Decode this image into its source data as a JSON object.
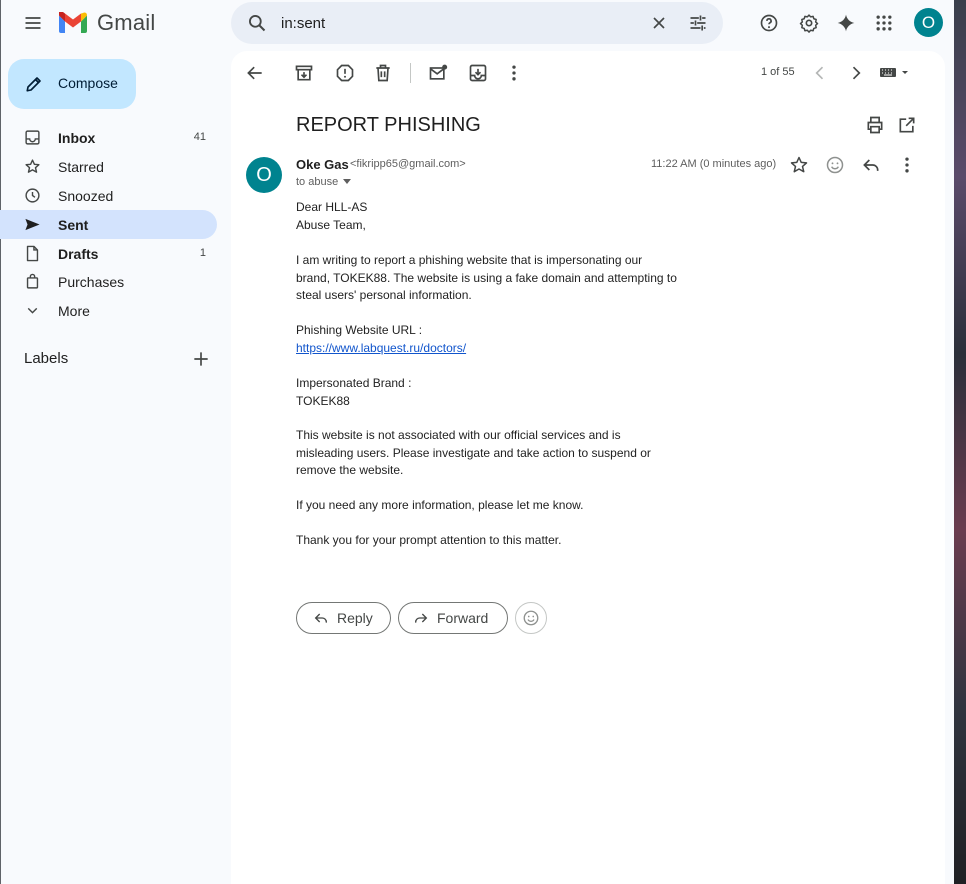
{
  "app": {
    "name": "Gmail"
  },
  "search": {
    "query": "in:sent"
  },
  "account": {
    "initial": "O"
  },
  "compose": {
    "label": "Compose"
  },
  "sidebar": {
    "items": [
      {
        "label": "Inbox",
        "count": "41",
        "icon": "inbox-icon"
      },
      {
        "label": "Starred",
        "count": "",
        "icon": "star-icon"
      },
      {
        "label": "Snoozed",
        "count": "",
        "icon": "clock-icon"
      },
      {
        "label": "Sent",
        "count": "",
        "icon": "send-icon"
      },
      {
        "label": "Drafts",
        "count": "1",
        "icon": "draft-icon"
      },
      {
        "label": "Purchases",
        "count": "",
        "icon": "shopping-bag-icon"
      },
      {
        "label": "More",
        "count": "",
        "icon": "chevron-down-icon"
      }
    ],
    "labels_title": "Labels"
  },
  "toolbar": {
    "pager": "1 of 55"
  },
  "email": {
    "subject": "REPORT PHISHING",
    "sender_initial": "O",
    "sender_name": "Oke Gas",
    "sender_email": "<fikripp65@gmail.com>",
    "to": "to abuse",
    "time": "11:22 AM (0 minutes ago)",
    "body": {
      "p1_l1": "Dear HLL-AS",
      "p1_l2": "Abuse Team,",
      "p2_l1": "I am writing to report a phishing website that is impersonating our",
      "p2_l2": "brand, TOKEK88. The website is using a fake domain and attempting to",
      "p2_l3": "steal users' personal information.",
      "p3_l1": "Phishing Website URL :",
      "p3_link": "https://www.labquest.ru/doctors/",
      "p4_l1": "Impersonated Brand :",
      "p4_l2": "TOKEK88",
      "p5_l1": "This website is not associated with our official services and is",
      "p5_l2": "misleading users. Please investigate and take action to suspend or",
      "p5_l3": "remove the website.",
      "p6": "If you need any more information, please let me know.",
      "p7": "Thank you for your prompt attention to this matter."
    },
    "reply_label": "Reply",
    "forward_label": "Forward"
  },
  "colors": {
    "background": "#f8fafd",
    "compose_bg": "#c2e7ff",
    "active_nav": "#d3e3fd",
    "avatar": "#00838f",
    "link": "#1155cc",
    "search_bg": "#e9eef6"
  }
}
